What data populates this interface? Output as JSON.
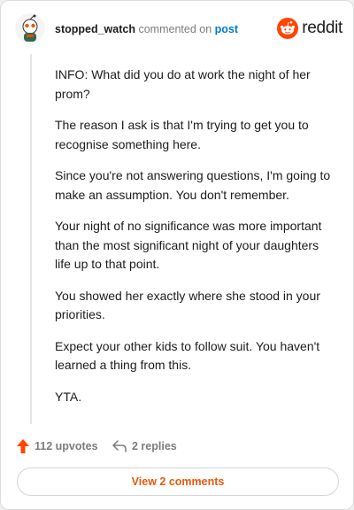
{
  "comment": {
    "username": "stopped_watch",
    "action_text": "commented on",
    "post_link": "post",
    "paragraphs": [
      "INFO: What did you do at work the night of her prom?",
      "The reason I ask is that I'm trying to get you to recognise something here.",
      "Since you're not answering questions, I'm going to make an assumption. You don't remember.",
      "Your night of no significance was more important than the most significant night of your daughters life up to that point.",
      "You showed her exactly where she stood in your priorities.",
      "Expect your other kids to follow suit. You haven't learned a thing from this.",
      "YTA."
    ]
  },
  "brand": {
    "name": "reddit",
    "icon": "reddit-logo-icon",
    "color": "#ff4500"
  },
  "footer": {
    "upvotes": "112 upvotes",
    "upvote_icon": "upvote-arrow-icon",
    "replies": "2 replies",
    "reply_icon": "reply-arrow-icon",
    "view_comments": "View 2 comments"
  },
  "colors": {
    "accent": "#ff4500",
    "link": "#0079d3",
    "button_text": "#e8590c"
  }
}
